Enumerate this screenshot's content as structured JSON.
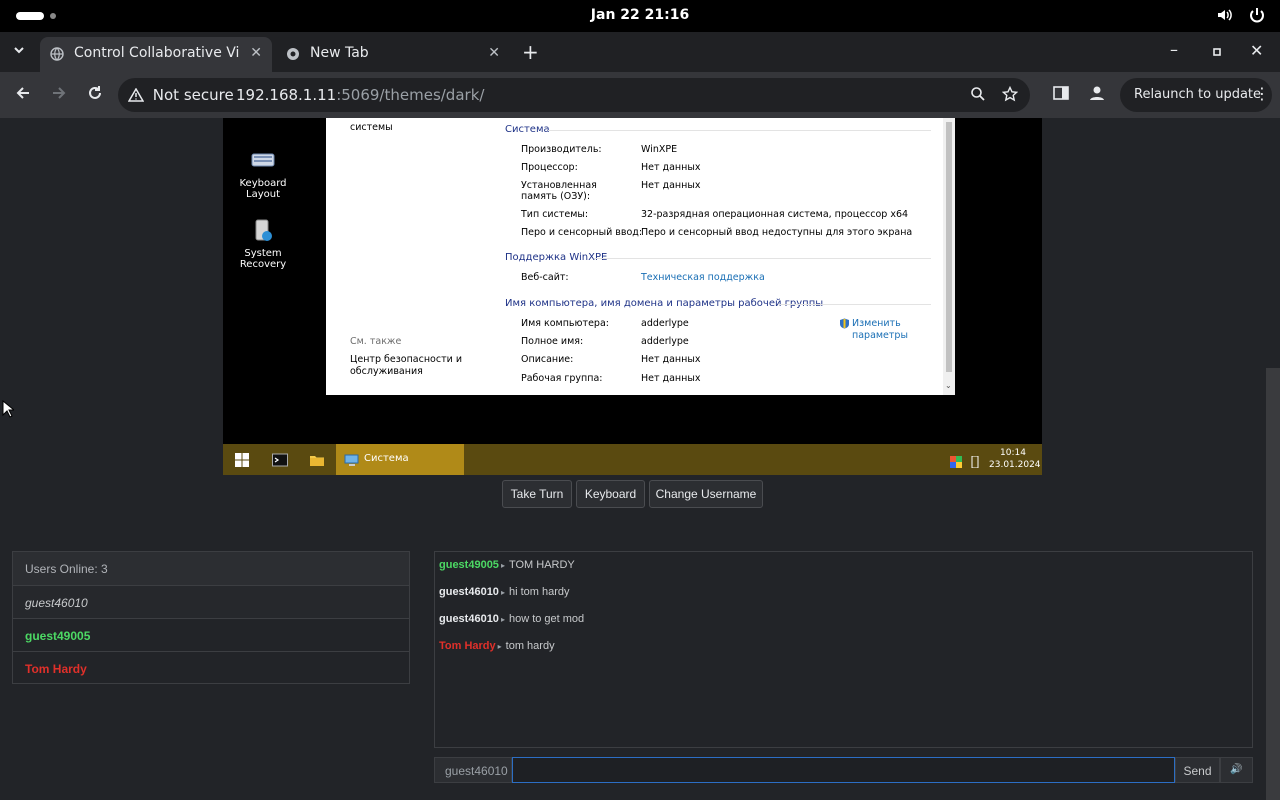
{
  "system_bar": {
    "datetime": "Jan 22  21:16",
    "volume_icon": "speaker-icon",
    "power_icon": "power-icon"
  },
  "browser": {
    "tabs": [
      {
        "title": "Control Collaborative Vi",
        "active": true
      },
      {
        "title": "New Tab",
        "active": false
      }
    ],
    "security_label": "Not secure",
    "url_host": "192.168.1.11",
    "url_rest": ":5069/themes/dark/",
    "relaunch_label": "Relaunch to update"
  },
  "vm_screen": {
    "desktop_icons": [
      {
        "label": "Keyboard Layout"
      },
      {
        "label": "System Recovery"
      }
    ],
    "window": {
      "left_top_text": "системы",
      "see_also": "См. также",
      "left_link": "Центр безопасности и обслуживания",
      "system_header": "Система",
      "rows_system": [
        {
          "label": "Производитель:",
          "value": "WinXPE"
        },
        {
          "label": "Процессор:",
          "value": "Нет данных"
        },
        {
          "label": "Установленная память (ОЗУ):",
          "value": "Нет данных"
        },
        {
          "label": "Тип системы:",
          "value": "32-разрядная операционная система, процессор x64"
        },
        {
          "label": "Перо и сенсорный ввод:",
          "value": "Перо и сенсорный ввод недоступны для этого экрана"
        }
      ],
      "support_header": "Поддержка WinXPE",
      "website_label": "Веб-сайт:",
      "website_link": "Техническая поддержка",
      "computer_header": "Имя компьютера, имя домена и параметры рабочей группы",
      "rows_computer": [
        {
          "label": "Имя компьютера:",
          "value": "adderlype"
        },
        {
          "label": "Полное имя:",
          "value": "adderlype"
        },
        {
          "label": "Описание:",
          "value": "Нет данных"
        },
        {
          "label": "Рабочая группа:",
          "value": "Нет данных"
        }
      ],
      "change_link": "Изменить параметры"
    },
    "taskbar": {
      "active_app": "Система",
      "time": "10:14",
      "date": "23.01.2024"
    }
  },
  "controls": {
    "take_turn": "Take Turn",
    "keyboard": "Keyboard",
    "change_username": "Change Username"
  },
  "users_panel": {
    "header": "Users Online: 3",
    "users": [
      {
        "name": "guest46010",
        "color": "#c8cacc",
        "style": "italic"
      },
      {
        "name": "guest49005",
        "color": "#4cd964",
        "style": "bold"
      },
      {
        "name": "Tom Hardy",
        "color": "#e0302a",
        "style": "bold"
      }
    ]
  },
  "chat": {
    "messages": [
      {
        "user": "guest49005",
        "color": "#4cd964",
        "text": "TOM HARDY"
      },
      {
        "user": "guest46010",
        "color": "#e8eaed",
        "text": "hi tom hardy"
      },
      {
        "user": "guest46010",
        "color": "#e8eaed",
        "text": "how to get mod"
      },
      {
        "user": "Tom Hardy",
        "color": "#e0302a",
        "text": "tom hardy"
      }
    ],
    "username": "guest46010",
    "input_value": "",
    "send_label": "Send",
    "sound_icon": "speaker-icon"
  }
}
